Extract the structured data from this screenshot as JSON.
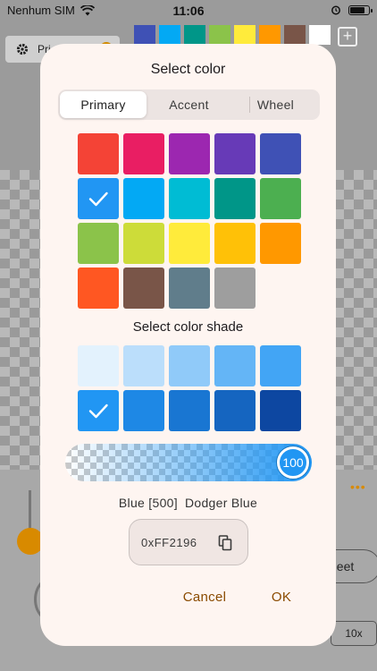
{
  "status_bar": {
    "carrier": "Nenhum SIM",
    "time": "11:06"
  },
  "background": {
    "chip_label": "Pri",
    "toolbar_swatches": [
      "#3f51b5",
      "#03a9f4",
      "#009688",
      "#8bc34a",
      "#ffeb3b",
      "#ff9800",
      "#795548",
      "#ffffff"
    ],
    "sheet_button": "heet",
    "zoom_button": "10x"
  },
  "dialog": {
    "title": "Select color",
    "tabs": [
      "Primary",
      "Accent",
      "Wheel"
    ],
    "selected_tab": "Primary",
    "primary_colors": [
      "#f44336",
      "#e91e63",
      "#9c27b0",
      "#673ab7",
      "#3f51b5",
      "#2196f3",
      "#03a9f4",
      "#00bcd4",
      "#009688",
      "#4caf50",
      "#8bc34a",
      "#cddc39",
      "#ffeb3b",
      "#ffc107",
      "#ff9800",
      "#ff5722",
      "#795548",
      "#607d8b",
      "#9e9e9e"
    ],
    "selected_primary_index": 5,
    "shade_label": "Select color shade",
    "shades": [
      "#e3f2fd",
      "#bbdefb",
      "#90caf9",
      "#64b5f6",
      "#42a5f5",
      "#2196f3",
      "#1e88e5",
      "#1976d2",
      "#1565c0",
      "#0d47a1"
    ],
    "selected_shade_index": 5,
    "opacity_value": "100",
    "opacity_fraction": 1.0,
    "color_name": "Blue [500]",
    "color_alias": "Dodger Blue",
    "hex_value": "0xFF2196",
    "cancel_label": "Cancel",
    "ok_label": "OK",
    "accent_color": "#8a4a00"
  }
}
